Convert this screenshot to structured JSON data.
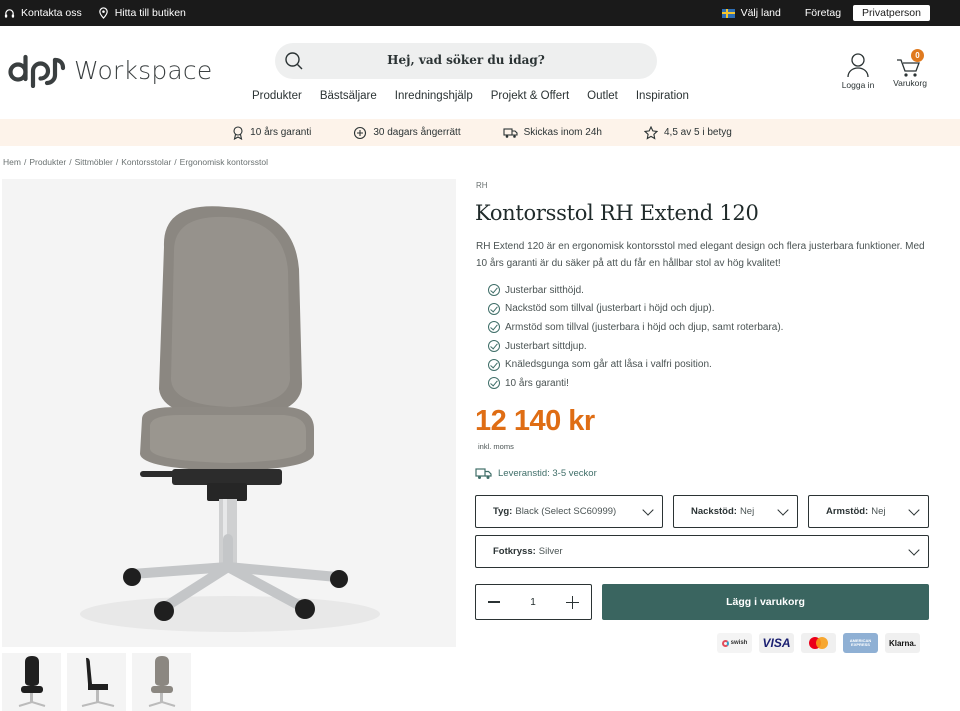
{
  "topbar": {
    "contact": "Kontakta oss",
    "find_store": "Hitta till butiken",
    "choose_country": "Välj land",
    "business": "Företag",
    "private": "Privatperson"
  },
  "header": {
    "logo_text": "Workspace",
    "search_placeholder": "Hej, vad söker du idag?",
    "nav": [
      "Produkter",
      "Bästsäljare",
      "Inredningshjälp",
      "Projekt & Offert",
      "Outlet",
      "Inspiration"
    ],
    "login": "Logga in",
    "cart": "Varukorg",
    "cart_count": "0"
  },
  "usp": [
    "10 års garanti",
    "30 dagars ångerrätt",
    "Skickas inom 24h",
    "4,5 av 5 i betyg"
  ],
  "breadcrumb": [
    "Hem",
    "Produkter",
    "Sittmöbler",
    "Kontorsstolar",
    "Ergonomisk kontorsstol"
  ],
  "product": {
    "brand": "RH",
    "title": "Kontorsstol RH Extend 120",
    "description": "RH Extend 120 är en ergonomisk kontorsstol med elegant design och flera justerbara funktioner. Med 10 års garanti är du säker på att du får en hållbar stol av hög kvalitet!",
    "features": [
      "Justerbar sitthöjd.",
      "Nackstöd som tillval (justerbart i höjd och djup).",
      "Armstöd som tillval (justerbara i höjd och djup, samt roterbara).",
      "Justerbart sittdjup.",
      "Knäledsgunga som går att låsa i valfri position.",
      "10 års garanti!"
    ],
    "price": "12 140 kr",
    "vat_note": "inkl. moms",
    "lead_time": "Leveranstid: 3-5 veckor",
    "options": {
      "fabric_label": "Tyg:",
      "fabric_value": "Black (Select SC60999)",
      "headrest_label": "Nackstöd:",
      "headrest_value": "Nej",
      "armrest_label": "Armstöd:",
      "armrest_value": "Nej",
      "base_label": "Fotkryss:",
      "base_value": "Silver"
    },
    "quantity": "1",
    "add_to_cart": "Lägg i varukorg"
  },
  "payment_methods": [
    "swish",
    "VISA",
    "Mastercard",
    "AMERICAN EXPRESS",
    "Klarna."
  ],
  "colors": {
    "accent": "#df6d14",
    "primary": "#3a6560",
    "usp_bg": "#fdf3ea",
    "topbar_bg": "#1a1a1a"
  }
}
